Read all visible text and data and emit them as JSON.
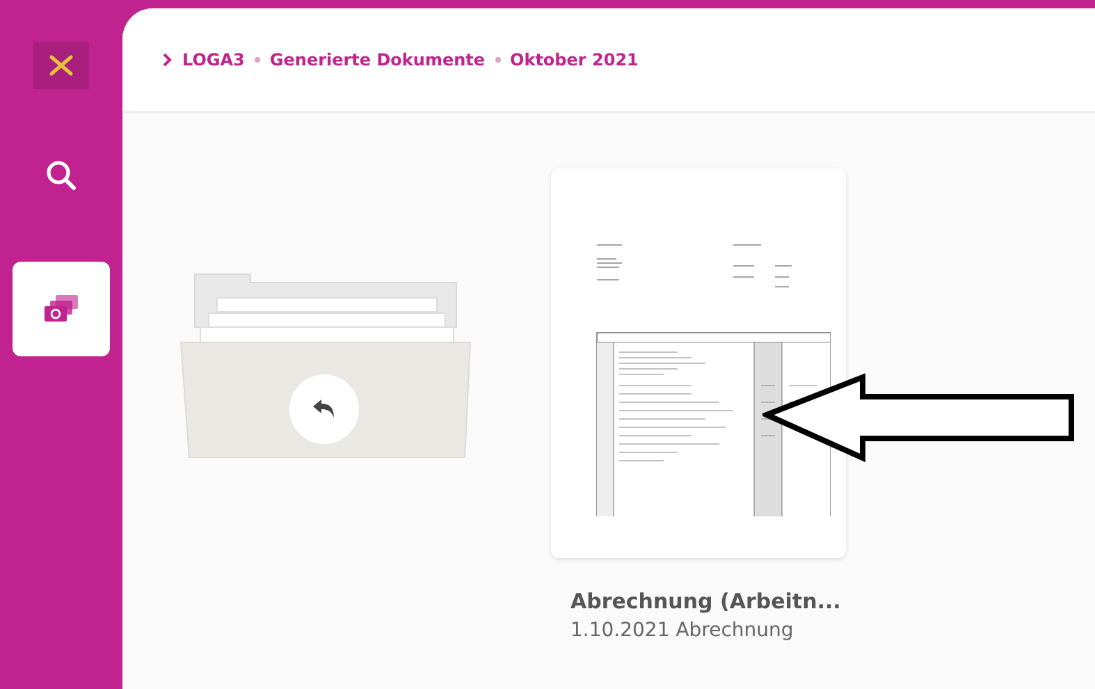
{
  "sidebar": {
    "items": [
      {
        "kind": "logo"
      },
      {
        "kind": "search",
        "selected": false
      },
      {
        "kind": "documents",
        "selected": true
      }
    ]
  },
  "breadcrumb": [
    "LOGA3",
    "Generierte Dokumente",
    "Oktober 2021"
  ],
  "cards": [
    {
      "kind": "folder-up"
    },
    {
      "kind": "document",
      "title": "Abrechnung (Arbeitn...",
      "subtitle": "1.10.2021 Abrechnung"
    }
  ],
  "annotation": {
    "kind": "arrow-left"
  }
}
